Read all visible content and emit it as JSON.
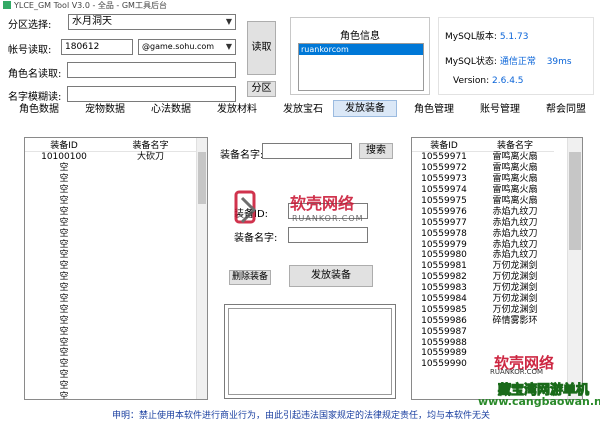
{
  "window": {
    "title": "YLCE_GM Tool V3.0 - 全品 - GM工具后台"
  },
  "form": {
    "zone_label": "分区选择:",
    "zone_value": "水月洞天",
    "account_label": "帐号读取:",
    "account_value": "180612",
    "domain_value": "@game.sohu.com",
    "rolename_label": "角色名读取:",
    "fuzzy_label": "名字模糊读:",
    "read_button": "读取",
    "zone_button": "分区"
  },
  "role_info": {
    "title": "角色信息",
    "selected_item": "ruankorcom"
  },
  "mysql": {
    "version_label": "MySQL版本:",
    "version_value": "5.1.73",
    "status_label": "MySQL状态:",
    "status_value": "通信正常",
    "latency": "39ms",
    "version2_label": "Version:",
    "version2_value": "2.6.4.5"
  },
  "tabs": [
    "角色数据",
    "宠物数据",
    "心法数据",
    "发放材料",
    "发放宝石",
    "发放装备",
    "角色管理",
    "账号管理",
    "帮会同盟"
  ],
  "active_tab_index": 5,
  "left_list": {
    "headers": [
      "装备ID",
      "装备名字"
    ],
    "rows": [
      [
        "10100100",
        "大砍刀"
      ],
      [
        "空",
        ""
      ],
      [
        "空",
        ""
      ],
      [
        "空",
        ""
      ],
      [
        "空",
        ""
      ],
      [
        "空",
        ""
      ],
      [
        "空",
        ""
      ],
      [
        "空",
        ""
      ],
      [
        "空",
        ""
      ],
      [
        "空",
        ""
      ],
      [
        "空",
        ""
      ],
      [
        "空",
        ""
      ],
      [
        "空",
        ""
      ],
      [
        "空",
        ""
      ],
      [
        "空",
        ""
      ],
      [
        "空",
        ""
      ],
      [
        "空",
        ""
      ],
      [
        "空",
        ""
      ],
      [
        "空",
        ""
      ],
      [
        "空",
        ""
      ],
      [
        "空",
        ""
      ],
      [
        "空",
        ""
      ],
      [
        "空",
        ""
      ]
    ]
  },
  "middle": {
    "search_label": "装备名字:",
    "search_button": "搜索",
    "equip_id_label": "装备ID:",
    "equip_name_label": "装备名字:",
    "delete_button": "删除装备",
    "issue_button": "发放装备"
  },
  "right_list": {
    "headers": [
      "装备ID",
      "装备名字"
    ],
    "rows": [
      [
        "10559971",
        "雷鸣离火扇"
      ],
      [
        "10559972",
        "雷鸣离火扇"
      ],
      [
        "10559973",
        "雷鸣离火扇"
      ],
      [
        "10559974",
        "雷鸣离火扇"
      ],
      [
        "10559975",
        "雷鸣离火扇"
      ],
      [
        "10559976",
        "赤焰九纹刀"
      ],
      [
        "10559977",
        "赤焰九纹刀"
      ],
      [
        "10559978",
        "赤焰九纹刀"
      ],
      [
        "10559979",
        "赤焰九纹刀"
      ],
      [
        "10559980",
        "赤焰九纹刀"
      ],
      [
        "10559981",
        "万仞龙渊剑"
      ],
      [
        "10559982",
        "万仞龙渊剑"
      ],
      [
        "10559983",
        "万仞龙渊剑"
      ],
      [
        "10559984",
        "万仞龙渊剑"
      ],
      [
        "10559985",
        "万仞龙渊剑"
      ],
      [
        "10559986",
        "碎情雾影环"
      ],
      [
        "10559987",
        ""
      ],
      [
        "10559988",
        ""
      ],
      [
        "10559989",
        ""
      ],
      [
        "10559990",
        ""
      ]
    ]
  },
  "watermarks": {
    "brand_cn": "软壳网络",
    "brand_url": "RUANKOR.COM",
    "site_cn": "藏宝湾网游单机",
    "site_url": "www.cangbaowan.net"
  },
  "footer": {
    "text": "申明：禁止使用本软件进行商业行为，由此引起违法国家规定的法律规定责任，均与本软件无关"
  },
  "colors": {
    "accent_blue": "#0a64d8",
    "selection_blue": "#0078d7",
    "status_green": "#0a8a0a",
    "brand_red": "#c8102e"
  }
}
